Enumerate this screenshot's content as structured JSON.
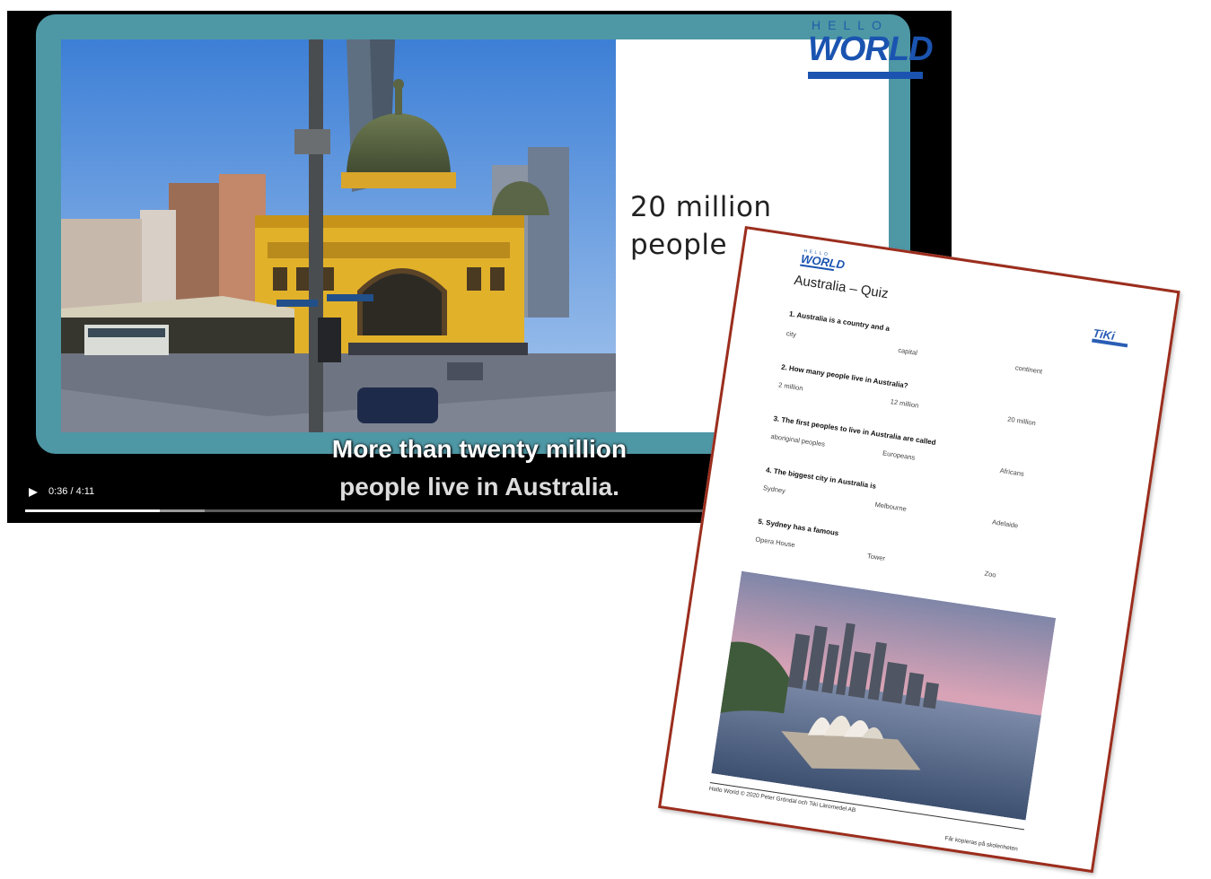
{
  "player": {
    "slide": {
      "text_line1": "20 million",
      "text_line2": "people",
      "logo_top": "HELLO",
      "logo_main": "WORLD"
    },
    "subtitles": {
      "line1": "More than twenty million",
      "line2": "people live in Australia."
    },
    "controls": {
      "play_icon": "play-icon",
      "time": "0:36 / 4:11",
      "progress_fraction": 0.1476,
      "buffered_fraction": 0.197
    },
    "colors": {
      "frame": "#4e97a5",
      "background": "#000000"
    }
  },
  "worksheet": {
    "logo_top": "HELLO",
    "logo_main": "WORLD",
    "title": "Australia – Quiz",
    "publisher_logo": "TiKi",
    "questions": [
      {
        "text": "1. Australia is a country and a",
        "options": [
          "city",
          "capital",
          "continent"
        ]
      },
      {
        "text": "2. How many people live in Australia?",
        "options": [
          "2 million",
          "12 million",
          "20 million"
        ]
      },
      {
        "text": "3. The first peoples to live in Australia are called",
        "options": [
          "aboriginal peoples",
          "Europeans",
          "Africans"
        ]
      },
      {
        "text": "4. The biggest city in Australia is",
        "options": [
          "Sydney",
          "Melbourne",
          "Adelaide"
        ]
      },
      {
        "text": "5. Sydney has a famous",
        "options": [
          "Opera House",
          "Tower",
          "Zoo"
        ]
      }
    ],
    "footer_left": "Hello World © 2020 Peter Gröndal och Tiki Läromedel AB",
    "footer_right": "Får kopieras på skolenheten",
    "colors": {
      "border": "#9b2d1d"
    }
  }
}
